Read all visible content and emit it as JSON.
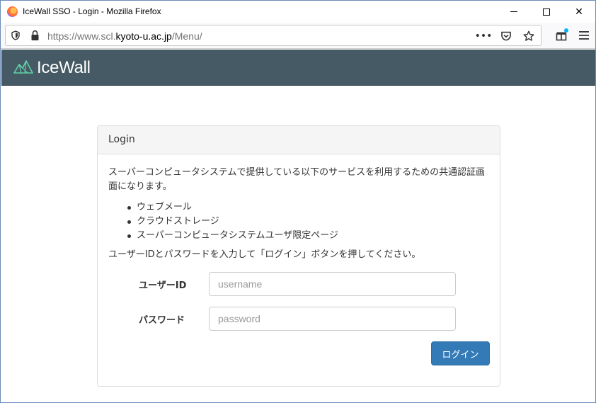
{
  "window": {
    "title": "IceWall SSO - Login - Mozilla Firefox"
  },
  "browser": {
    "url_prefix": "https://www.scl.",
    "url_host": "kyoto-u.ac.jp",
    "url_path": "/Menu/",
    "icons": [
      "shield-icon",
      "lock-icon",
      "more-icon",
      "pocket-icon",
      "star-icon",
      "extensions-icon",
      "menu-icon"
    ]
  },
  "site": {
    "brand": "IceWall",
    "header_color": "#455a64"
  },
  "panel": {
    "heading": "Login",
    "intro": "スーパーコンピュータシステムで提供している以下のサービスを利用するための共通認証画面になります。",
    "services": [
      "ウェブメール",
      "クラウドストレージ",
      "スーパーコンピュータシステムユーザ限定ページ"
    ],
    "instruction": "ユーザーIDとパスワードを入力して「ログイン」ボタンを押してください。"
  },
  "form": {
    "username_label": "ユーザーID",
    "username_placeholder": "username",
    "username_value": "",
    "password_label": "パスワード",
    "password_placeholder": "password",
    "password_value": "",
    "submit_label": "ログイン",
    "submit_color": "#337ab7"
  }
}
